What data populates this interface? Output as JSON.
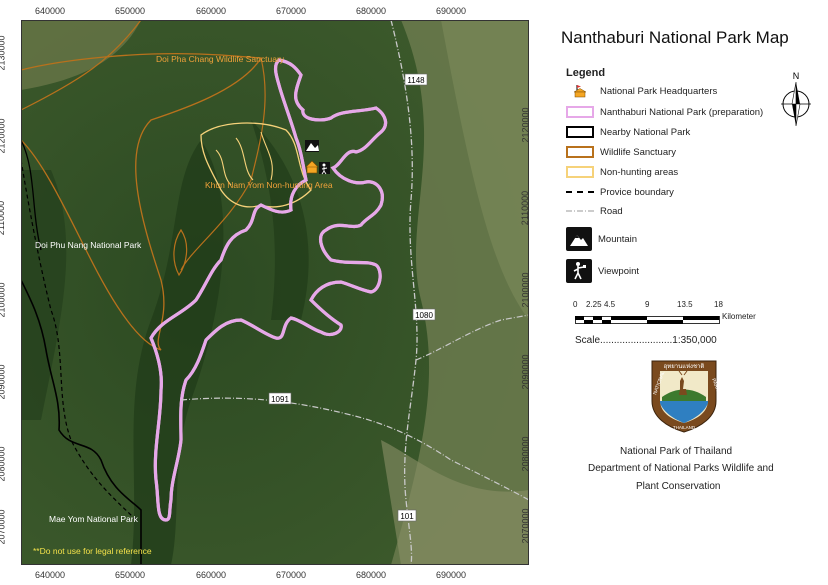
{
  "title": "Nanthaburi National Park Map",
  "legend": {
    "title": "Legend",
    "items": [
      {
        "label": "National Park Headquarters",
        "icon": "hq-icon",
        "color": "#f5a623"
      },
      {
        "label": "Nanthaburi National Park (preparation)",
        "color": "#e6a8e8"
      },
      {
        "label": "Nearby National Park",
        "color": "#000000"
      },
      {
        "label": "Wildlife Sanctuary",
        "color": "#b8711c"
      },
      {
        "label": "Non-hunting areas",
        "color": "#f6d27a"
      },
      {
        "label": "Provice boundary",
        "style": "dashed",
        "color": "#000000"
      },
      {
        "label": "Road",
        "style": "dash-dot",
        "color": "#bbbbbb"
      },
      {
        "label": "Mountain",
        "icon": "mountain-icon"
      },
      {
        "label": "Viewpoint",
        "icon": "viewpoint-icon"
      }
    ]
  },
  "north_arrow": {
    "label": "N"
  },
  "scale_bar": {
    "ticks": [
      "0",
      "2.25",
      "4.5",
      "9",
      "13.5",
      "18"
    ],
    "unit": "Kilometer",
    "text": "Scale..........................1:350,000"
  },
  "map": {
    "x_ticks": [
      "640000",
      "650000",
      "660000",
      "670000",
      "680000",
      "690000"
    ],
    "y_ticks": [
      "2130000",
      "2120000",
      "2110000",
      "2100000",
      "2090000",
      "2080000",
      "2070000"
    ],
    "labels": {
      "doi_pha_chang": "Doi Pha Chang Wildlife Sanctuary",
      "khun_nam_yom": "Khun Nam Yom Non-hunting Area",
      "doi_phu_nang": "Doi Phu Nang National Park",
      "mae_yom": "Mae Yom National Park",
      "disclaimer": "**Do not use for legal reference"
    },
    "roads": [
      "1148",
      "1080",
      "1091",
      "101"
    ]
  },
  "emblem": {
    "text_top": "อุทยานแห่งชาติ",
    "text_left": "NATIONAL",
    "text_right": "PARK",
    "text_bottom": "THAILAND"
  },
  "footer": {
    "line1": "National Park of Thailand",
    "line2": "Department of National Parks Wildlife and",
    "line3": "Plant Conservation"
  }
}
